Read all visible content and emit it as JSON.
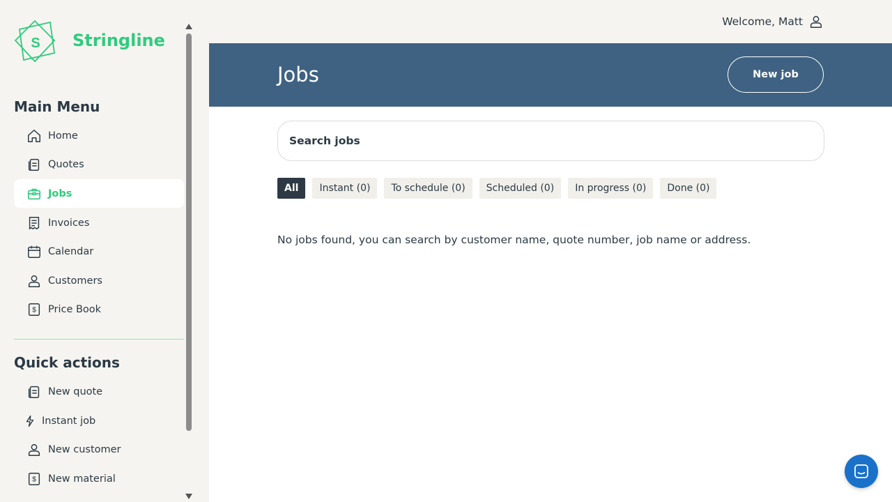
{
  "app": {
    "name": "Stringline",
    "logo_letter": "S",
    "brand_color": "#2fcc7e",
    "header_color": "#3f6282"
  },
  "user": {
    "welcome": "Welcome, Matt"
  },
  "sidebar": {
    "main_menu_title": "Main Menu",
    "items": [
      {
        "label": "Home",
        "icon": "home-icon"
      },
      {
        "label": "Quotes",
        "icon": "quotes-icon"
      },
      {
        "label": "Jobs",
        "icon": "jobs-icon",
        "active": true
      },
      {
        "label": "Invoices",
        "icon": "invoices-icon"
      },
      {
        "label": "Calendar",
        "icon": "calendar-icon"
      },
      {
        "label": "Customers",
        "icon": "customers-icon"
      },
      {
        "label": "Price Book",
        "icon": "price-book-icon"
      }
    ],
    "quick_actions_title": "Quick actions",
    "quick_actions": [
      {
        "label": "New quote",
        "icon": "new-quote-icon"
      },
      {
        "label": "Instant job",
        "icon": "lightning-icon"
      },
      {
        "label": "New customer",
        "icon": "new-customer-icon"
      },
      {
        "label": "New material",
        "icon": "new-material-icon"
      }
    ]
  },
  "main": {
    "title": "Jobs",
    "new_job_label": "New job",
    "search_placeholder": "Search jobs",
    "tabs": [
      {
        "label": "All",
        "active": true
      },
      {
        "label": "Instant (0)"
      },
      {
        "label": "To schedule (0)"
      },
      {
        "label": "Scheduled (0)"
      },
      {
        "label": "In progress (0)"
      },
      {
        "label": "Done (0)"
      }
    ],
    "empty_message": "No jobs found, you can search by customer name, quote number, job name or address."
  }
}
